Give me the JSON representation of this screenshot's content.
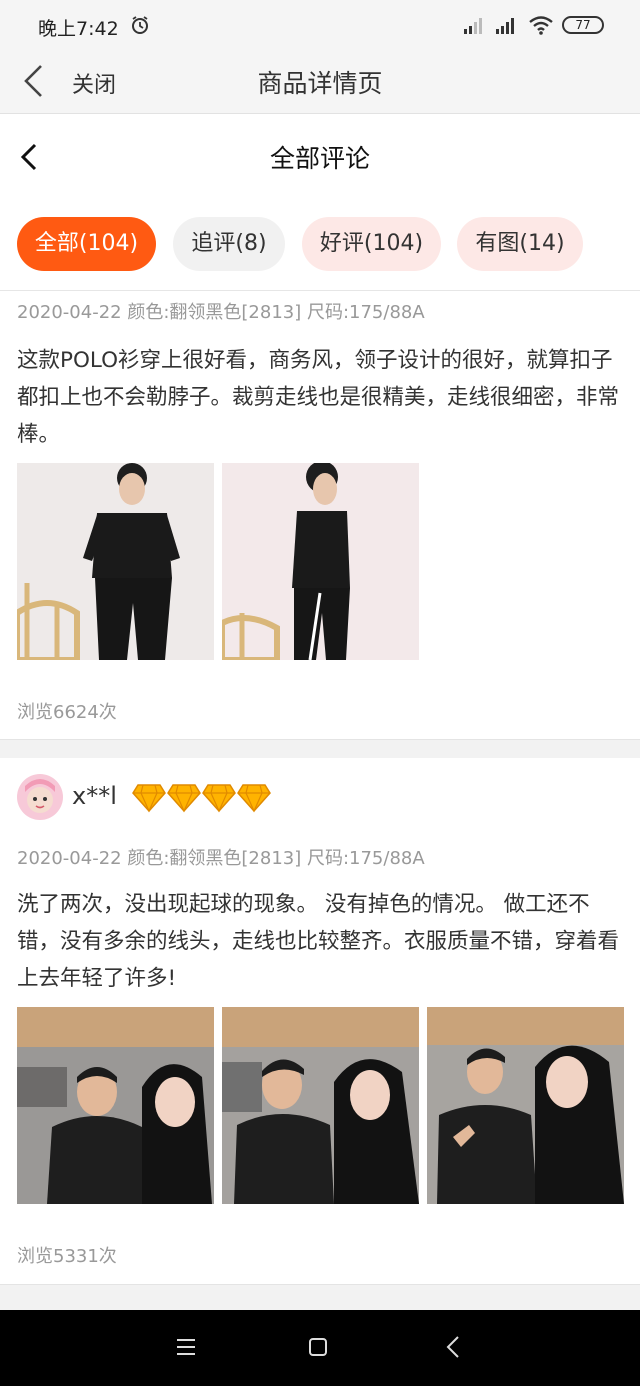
{
  "status_bar": {
    "time": "晚上7:42",
    "battery": "77",
    "icons": [
      "alarm-icon",
      "signal-icon",
      "signal-icon",
      "wifi-icon",
      "battery-icon"
    ]
  },
  "nav": {
    "close_label": "关闭",
    "title": "商品详情页",
    "back_icon": "chevron-left-icon"
  },
  "comments": {
    "title": "全部评论",
    "back_icon": "chevron-left-icon"
  },
  "filters": [
    {
      "label": "全部(104)",
      "active": true
    },
    {
      "label": "追评(8)",
      "active": false
    },
    {
      "label": "好评(104)",
      "active": false
    },
    {
      "label": "有图(14)",
      "active": false
    }
  ],
  "reviews": [
    {
      "meta": "2020-04-22 颜色:翻领黑色[2813] 尺码:175/88A",
      "text": "这款POLO衫穿上很好看，商务风，领子设计的很好，就算扣子都扣上也不会勒脖子。裁剪走线也是很精美，走线很细密，非常棒。",
      "photos": [
        "photo-man-front",
        "photo-man-side"
      ],
      "views": "浏览6624次"
    },
    {
      "username": "x**l",
      "level_diamonds": 4,
      "meta": "2020-04-22 颜色:翻领黑色[2813] 尺码:175/88A",
      "text": "洗了两次，没出现起球的现象。 没有掉色的情况。 做工还不错，没有多余的线头，走线也比较整齐。衣服质量不错，穿着看上去年轻了许多!",
      "photos": [
        "photo-couple-1",
        "photo-couple-2",
        "photo-couple-3"
      ],
      "views": "浏览5331次"
    }
  ],
  "colors": {
    "accent": "#ff5a12",
    "chip_pink": "#fde8e6",
    "chip_gray": "#f1f1f1",
    "diamond": "#ffb300"
  },
  "system_nav": {
    "icons": [
      "menu-icon",
      "home-icon",
      "back-icon"
    ]
  }
}
